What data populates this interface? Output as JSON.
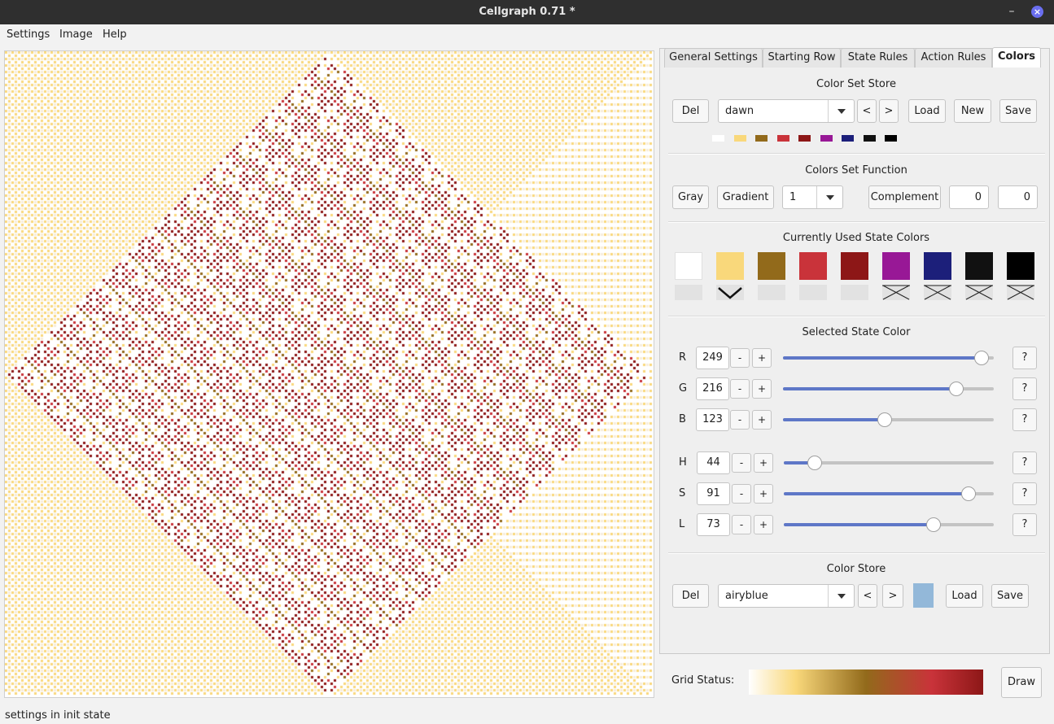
{
  "window": {
    "title": "Cellgraph 0.71 *",
    "minimize": "–",
    "close": "×"
  },
  "menu": [
    "Settings",
    "Image",
    "Help"
  ],
  "tabs": [
    "General Settings",
    "Starting Row",
    "State Rules",
    "Action Rules",
    "Colors"
  ],
  "active_tab": "Colors",
  "colorset_store": {
    "title": "Color Set Store",
    "del": "Del",
    "selected": "dawn",
    "prev": "<",
    "next": ">",
    "load": "Load",
    "new": "New",
    "save": "Save",
    "swatches": [
      "#ffffff",
      "#f9d87b",
      "#926a1b",
      "#c9333a",
      "#8d1717",
      "#981896",
      "#1c1f7a",
      "#111111",
      "#000000"
    ]
  },
  "colors_set_function": {
    "title": "Colors Set Function",
    "gray": "Gray",
    "gradient": "Gradient",
    "gradient_value": "1",
    "complement": "Complement",
    "value1": "0",
    "value2": "0"
  },
  "state_colors": {
    "title": "Currently Used State Colors",
    "colors": [
      "#ffffff",
      "#f9d87b",
      "#926a1b",
      "#c9333a",
      "#8d1717",
      "#981896",
      "#1c1f7a",
      "#111111",
      "#000000"
    ],
    "selected_index": 1,
    "unused_from_index": 5
  },
  "selected_state_color": {
    "title": "Selected State Color",
    "channels": [
      {
        "label": "R",
        "value": "249",
        "fraction": 0.976
      },
      {
        "label": "G",
        "value": "216",
        "fraction": 0.847
      },
      {
        "label": "B",
        "value": "123",
        "fraction": 0.482
      },
      {
        "label": "H",
        "value": "44",
        "fraction": 0.122
      },
      {
        "label": "S",
        "value": "91",
        "fraction": 0.91
      },
      {
        "label": "L",
        "value": "73",
        "fraction": 0.73
      }
    ],
    "minus": "-",
    "plus": "+",
    "help": "?"
  },
  "color_store": {
    "title": "Color Store",
    "del": "Del",
    "selected": "airyblue",
    "prev": "<",
    "next": ">",
    "preview_color": "#93b8d9",
    "load": "Load",
    "save": "Save"
  },
  "grid_status": {
    "label": "Grid Status:",
    "draw": "Draw"
  },
  "status_text": "settings in init state"
}
